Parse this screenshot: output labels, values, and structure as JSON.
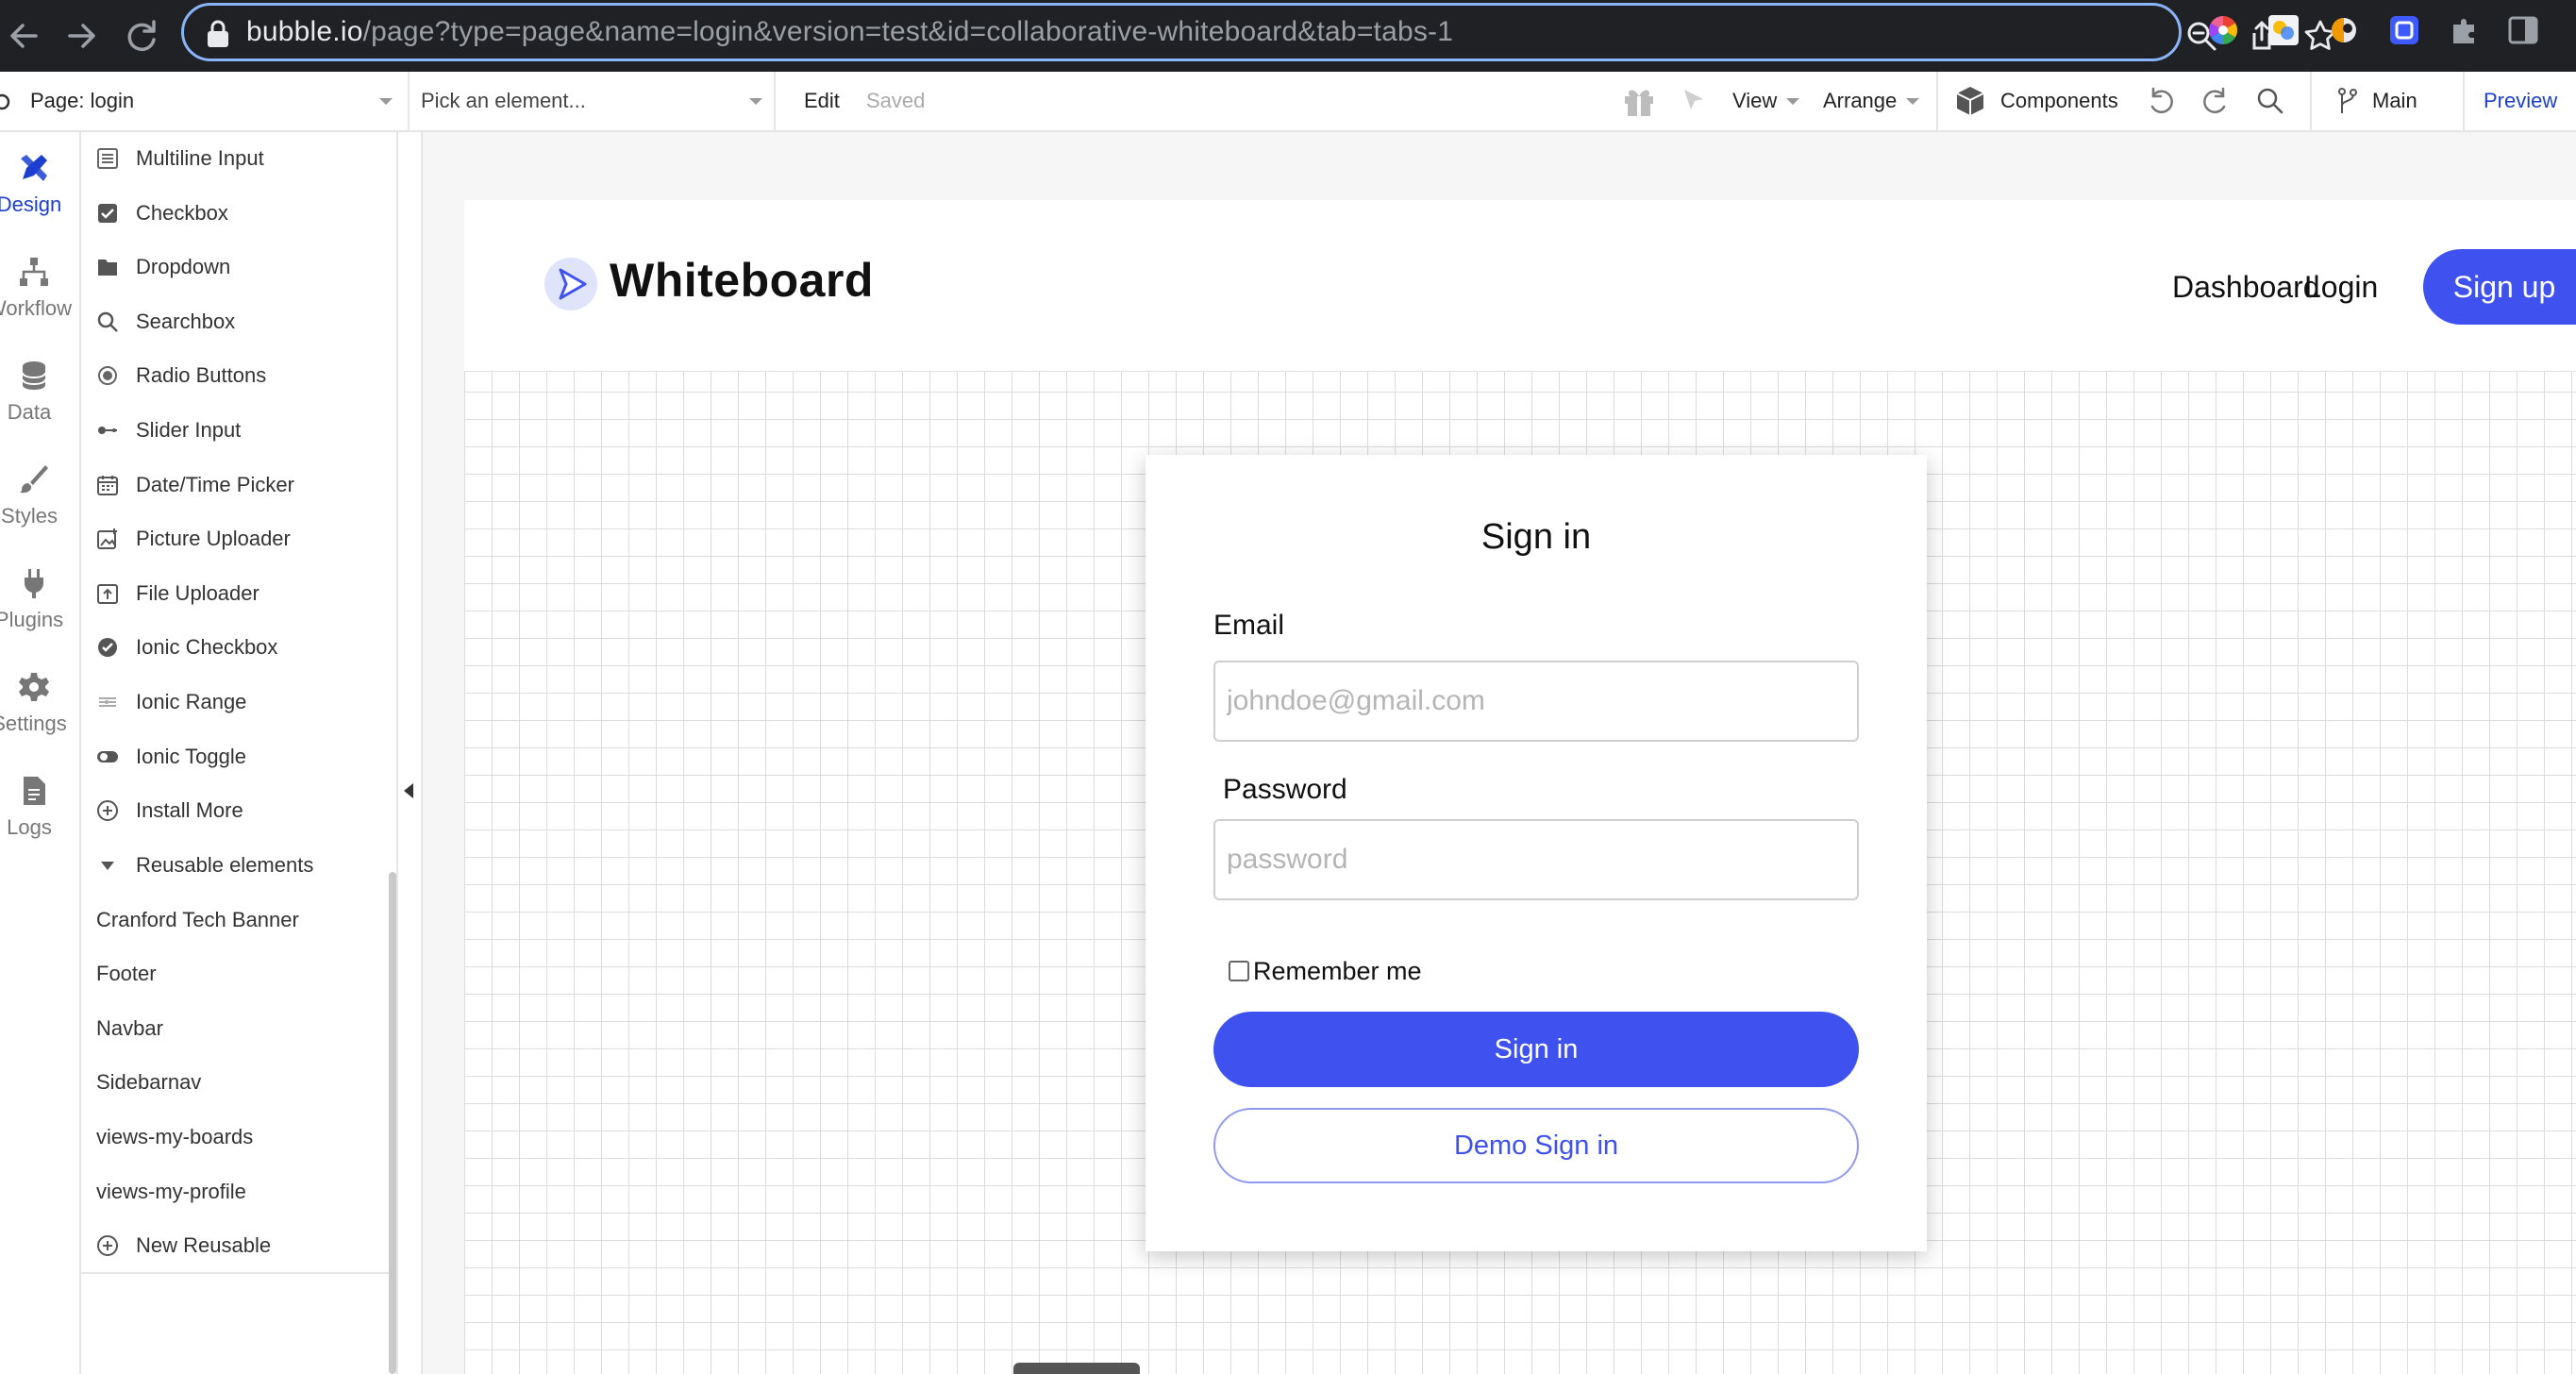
{
  "browser": {
    "url_host": "bubble.io",
    "url_path": "/page?type=page&name=login&version=test&id=collaborative-whiteboard&tab=tabs-1",
    "actions": [
      "zoom-icon",
      "share-icon",
      "bookmark-star-icon"
    ],
    "extensions": [
      "color-wheel-extension-icon",
      "photo-extension-icon",
      "half-moon-extension-icon",
      "blue-square-extension-icon",
      "puzzle-extensions-icon",
      "side-panel-icon"
    ]
  },
  "toolbar": {
    "page_label": "Page: login",
    "element_picker": "Pick an element...",
    "edit_label": "Edit",
    "saved_label": "Saved",
    "view_label": "View",
    "arrange_label": "Arrange",
    "components_label": "Components",
    "branch_label": "Main",
    "preview_label": "Preview"
  },
  "rail": {
    "items": [
      {
        "label": "Design",
        "icon": "design-brush-icon",
        "active": true
      },
      {
        "label": "Workflow",
        "icon": "workflow-icon"
      },
      {
        "label": "Data",
        "icon": "database-icon"
      },
      {
        "label": "Styles",
        "icon": "paintbrush-icon"
      },
      {
        "label": "Plugins",
        "icon": "plug-icon"
      },
      {
        "label": "Settings",
        "icon": "gear-icon"
      },
      {
        "label": "Logs",
        "icon": "document-icon"
      }
    ]
  },
  "palette": {
    "inputs": [
      {
        "label": "Multiline Input",
        "icon": "multiline-input-icon"
      },
      {
        "label": "Checkbox",
        "icon": "checkbox-icon"
      },
      {
        "label": "Dropdown",
        "icon": "dropdown-icon"
      },
      {
        "label": "Searchbox",
        "icon": "search-icon"
      },
      {
        "label": "Radio Buttons",
        "icon": "radio-icon"
      },
      {
        "label": "Slider Input",
        "icon": "slider-icon"
      },
      {
        "label": "Date/Time Picker",
        "icon": "calendar-icon"
      },
      {
        "label": "Picture Uploader",
        "icon": "picture-upload-icon"
      },
      {
        "label": "File Uploader",
        "icon": "file-upload-icon"
      },
      {
        "label": "Ionic Checkbox",
        "icon": "ionic-checkbox-icon"
      },
      {
        "label": "Ionic Range",
        "icon": "ionic-range-icon"
      },
      {
        "label": "Ionic Toggle",
        "icon": "toggle-icon"
      },
      {
        "label": "Install More",
        "icon": "plus-circle-icon"
      }
    ],
    "reusable_header": "Reusable elements",
    "reusables": [
      "Cranford Tech Banner",
      "Footer",
      "Navbar",
      "Sidebarnav",
      "views-my-boards",
      "views-my-profile"
    ],
    "new_reusable": "New Reusable"
  },
  "app": {
    "logo_text": "Whiteboard",
    "nav": {
      "dashboard": "Dashboard",
      "login": "Login",
      "signup": "Sign up"
    },
    "card": {
      "title": "Sign in",
      "email_label": "Email",
      "email_placeholder": "johndoe@gmail.com",
      "password_label": "Password",
      "password_placeholder": "password",
      "remember_label": "Remember me",
      "signin_button": "Sign in",
      "demo_button": "Demo Sign in"
    }
  },
  "colors": {
    "brand_blue": "#3f51ee",
    "rail_active": "#1c3fd0",
    "browser_bg": "#202124",
    "url_focus": "#8ab4f8"
  }
}
